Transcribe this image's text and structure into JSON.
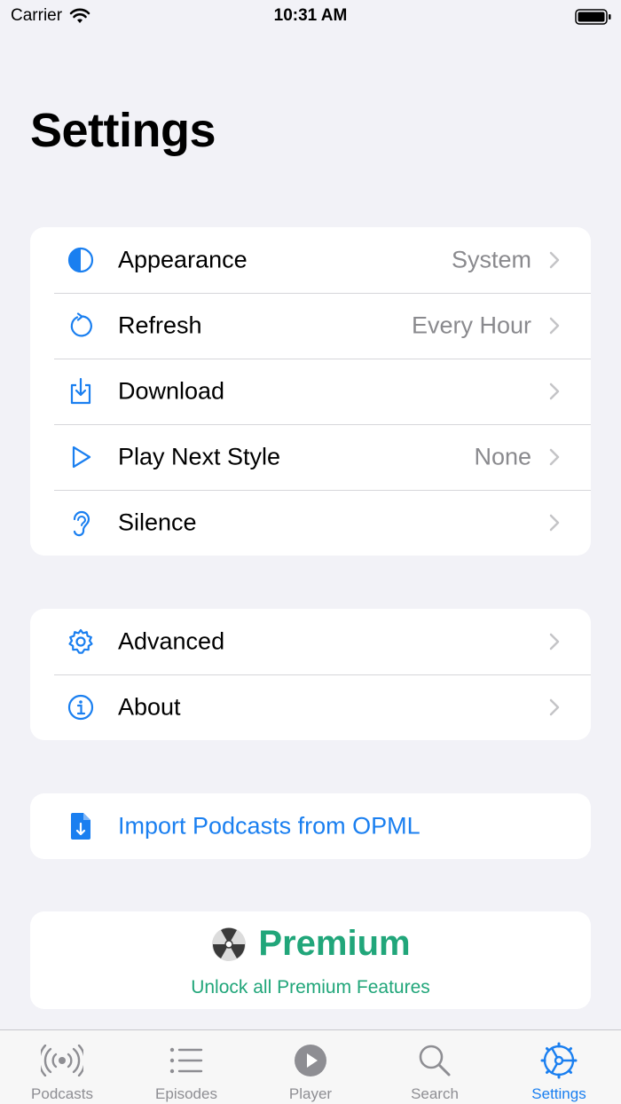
{
  "status_bar": {
    "carrier": "Carrier",
    "time": "10:31 AM"
  },
  "title": "Settings",
  "sections": {
    "general": [
      {
        "icon": "half-circle-icon",
        "label": "Appearance",
        "value": "System"
      },
      {
        "icon": "refresh-icon",
        "label": "Refresh",
        "value": "Every Hour"
      },
      {
        "icon": "download-tray-icon",
        "label": "Download",
        "value": ""
      },
      {
        "icon": "play-outline-icon",
        "label": "Play Next Style",
        "value": "None"
      },
      {
        "icon": "ear-icon",
        "label": "Silence",
        "value": ""
      }
    ],
    "more": [
      {
        "icon": "gear-icon",
        "label": "Advanced"
      },
      {
        "icon": "info-circle-icon",
        "label": "About"
      }
    ],
    "import": {
      "icon": "document-download-icon",
      "label": "Import Podcasts from OPML"
    }
  },
  "premium": {
    "icon": "fan-icon",
    "title": "Premium",
    "subtitle": "Unlock all Premium Features"
  },
  "tabs": [
    {
      "icon": "broadcast-icon",
      "label": "Podcasts",
      "active": false
    },
    {
      "icon": "list-icon",
      "label": "Episodes",
      "active": false
    },
    {
      "icon": "play-circle-icon",
      "label": "Player",
      "active": false
    },
    {
      "icon": "magnifier-icon",
      "label": "Search",
      "active": false
    },
    {
      "icon": "settings-wheel-icon",
      "label": "Settings",
      "active": true
    }
  ],
  "colors": {
    "accent": "#1a7ff0",
    "premium": "#21a67a",
    "secondary_text": "#8a8a8e",
    "background": "#f2f2f7"
  }
}
